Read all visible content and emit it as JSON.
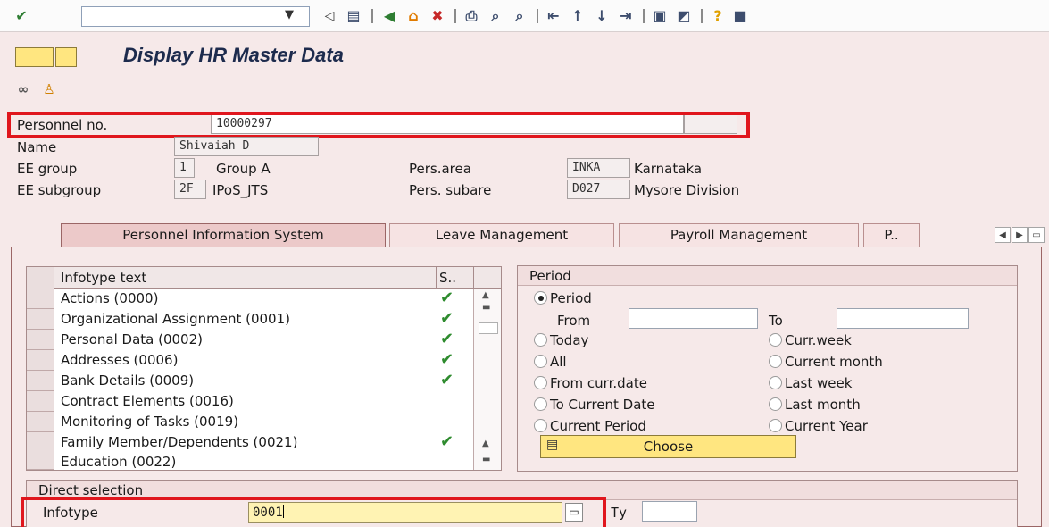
{
  "toolbar": {
    "command_field_value": "",
    "icons": [
      "enter-icon",
      "command-dropdown-icon",
      "back-triangle-icon",
      "save-icon",
      "back-icon",
      "exit-icon",
      "cancel-icon",
      "print-icon",
      "find-icon",
      "find-next-icon",
      "first-page-icon",
      "previous-page-icon",
      "next-page-icon",
      "last-page-icon",
      "create-session-icon",
      "shortcut-icon",
      "help-icon",
      "customize-layout-icon"
    ]
  },
  "header": {
    "title": "Display HR Master Data"
  },
  "fields": {
    "personnel_no_label": "Personnel no.",
    "personnel_no_value": "10000297",
    "name_label": "Name",
    "name_value": "Shivaiah D",
    "ee_group_label": "EE group",
    "ee_group_code": "1",
    "ee_group_text": "Group A",
    "ee_subgroup_label": "EE subgroup",
    "ee_subgroup_code": "2F",
    "ee_subgroup_text": "IPoS_JTS",
    "pers_area_label": "Pers.area",
    "pers_area_code": "INKA",
    "pers_area_text": "Karnataka",
    "pers_subarea_label": "Pers. subare",
    "pers_subarea_code": "D027",
    "pers_subarea_text": "Mysore Division"
  },
  "tabs": [
    {
      "label": "Personnel Information System",
      "active": true
    },
    {
      "label": "Leave Management",
      "active": false
    },
    {
      "label": "Payroll Management",
      "active": false
    },
    {
      "label": "P..",
      "active": false
    }
  ],
  "infotype_table": {
    "col_text": "Infotype text",
    "col_status": "S..",
    "rows": [
      {
        "text": "Actions (0000)",
        "exists": true
      },
      {
        "text": "Organizational Assignment (0001)",
        "exists": true
      },
      {
        "text": "Personal Data (0002)",
        "exists": true
      },
      {
        "text": "Addresses (0006)",
        "exists": true
      },
      {
        "text": "Bank Details (0009)",
        "exists": true
      },
      {
        "text": "Contract Elements (0016)",
        "exists": false
      },
      {
        "text": "Monitoring of Tasks (0019)",
        "exists": false
      },
      {
        "text": "Family Member/Dependents (0021)",
        "exists": true
      },
      {
        "text": "Education (0022)",
        "exists": false
      }
    ]
  },
  "period": {
    "title": "Period",
    "period_option": "Period",
    "from_label": "From",
    "from_value": "",
    "to_label": "To",
    "to_value": "",
    "options_left": [
      "Today",
      "All",
      "From curr.date",
      "To Current Date",
      "Current Period"
    ],
    "options_right": [
      "Curr.week",
      "Current month",
      "Last week",
      "Last month",
      "Current Year"
    ],
    "selected": "Period",
    "choose_label": "Choose"
  },
  "direct_selection": {
    "title": "Direct selection",
    "infotype_label": "Infotype",
    "infotype_value": "0001",
    "type_label": "Ty",
    "type_value": ""
  },
  "colors": {
    "highlight_red": "#e0161d",
    "check_green": "#2e8b2e",
    "button_yellow": "#ffe680",
    "background": "#f6e9e9"
  }
}
